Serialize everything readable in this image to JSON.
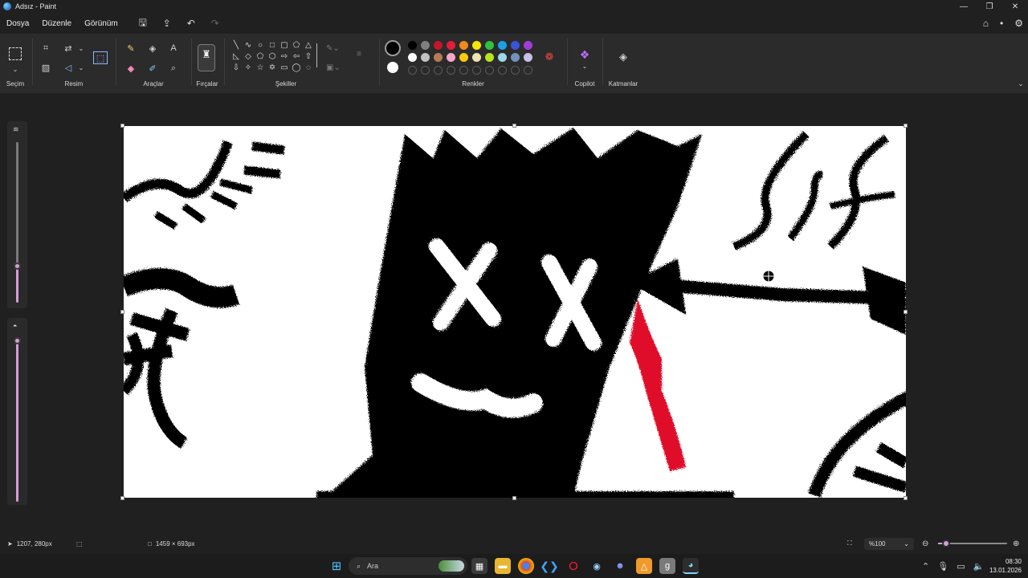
{
  "window": {
    "title": "Adsız - Paint",
    "min": "—",
    "max": "❐",
    "close": "✕"
  },
  "menu": {
    "items": [
      "Dosya",
      "Düzenle",
      "Görünüm"
    ]
  },
  "quick_access": {
    "save": "🖫",
    "share": "⇪",
    "undo": "↶",
    "redo": "↷"
  },
  "ribbon": {
    "groups": {
      "selection": "Seçim",
      "image": "Resim",
      "tools": "Araçlar",
      "brushes": "Fırçalar",
      "shapes": "Şekiller",
      "colors": "Renkler",
      "copilot": "Copilot",
      "layers": "Katmanlar"
    },
    "palette_row1": [
      "#000000",
      "#7f7f7f",
      "#c3162b",
      "#e51c3b",
      "#f08a1c",
      "#f5e50c",
      "#2ec23f",
      "#1ba0e6",
      "#3b53d9",
      "#a23cd9"
    ],
    "palette_row2": [
      "#ffffff",
      "#c3c3c3",
      "#b97a57",
      "#f7a6c9",
      "#ffc90e",
      "#efe4b0",
      "#b5e61d",
      "#99d9ea",
      "#7092be",
      "#c8bfe7"
    ],
    "primary_color": "#000000",
    "secondary_color": "#ffffff"
  },
  "status": {
    "cursor_pos": "1207, 280px",
    "canvas_size": "1459 × 693px",
    "zoom": "%100",
    "zoom_level": 0.12
  },
  "taskbar": {
    "search_placeholder": "Ara",
    "time": "08:30",
    "date": "13.01.2026"
  }
}
